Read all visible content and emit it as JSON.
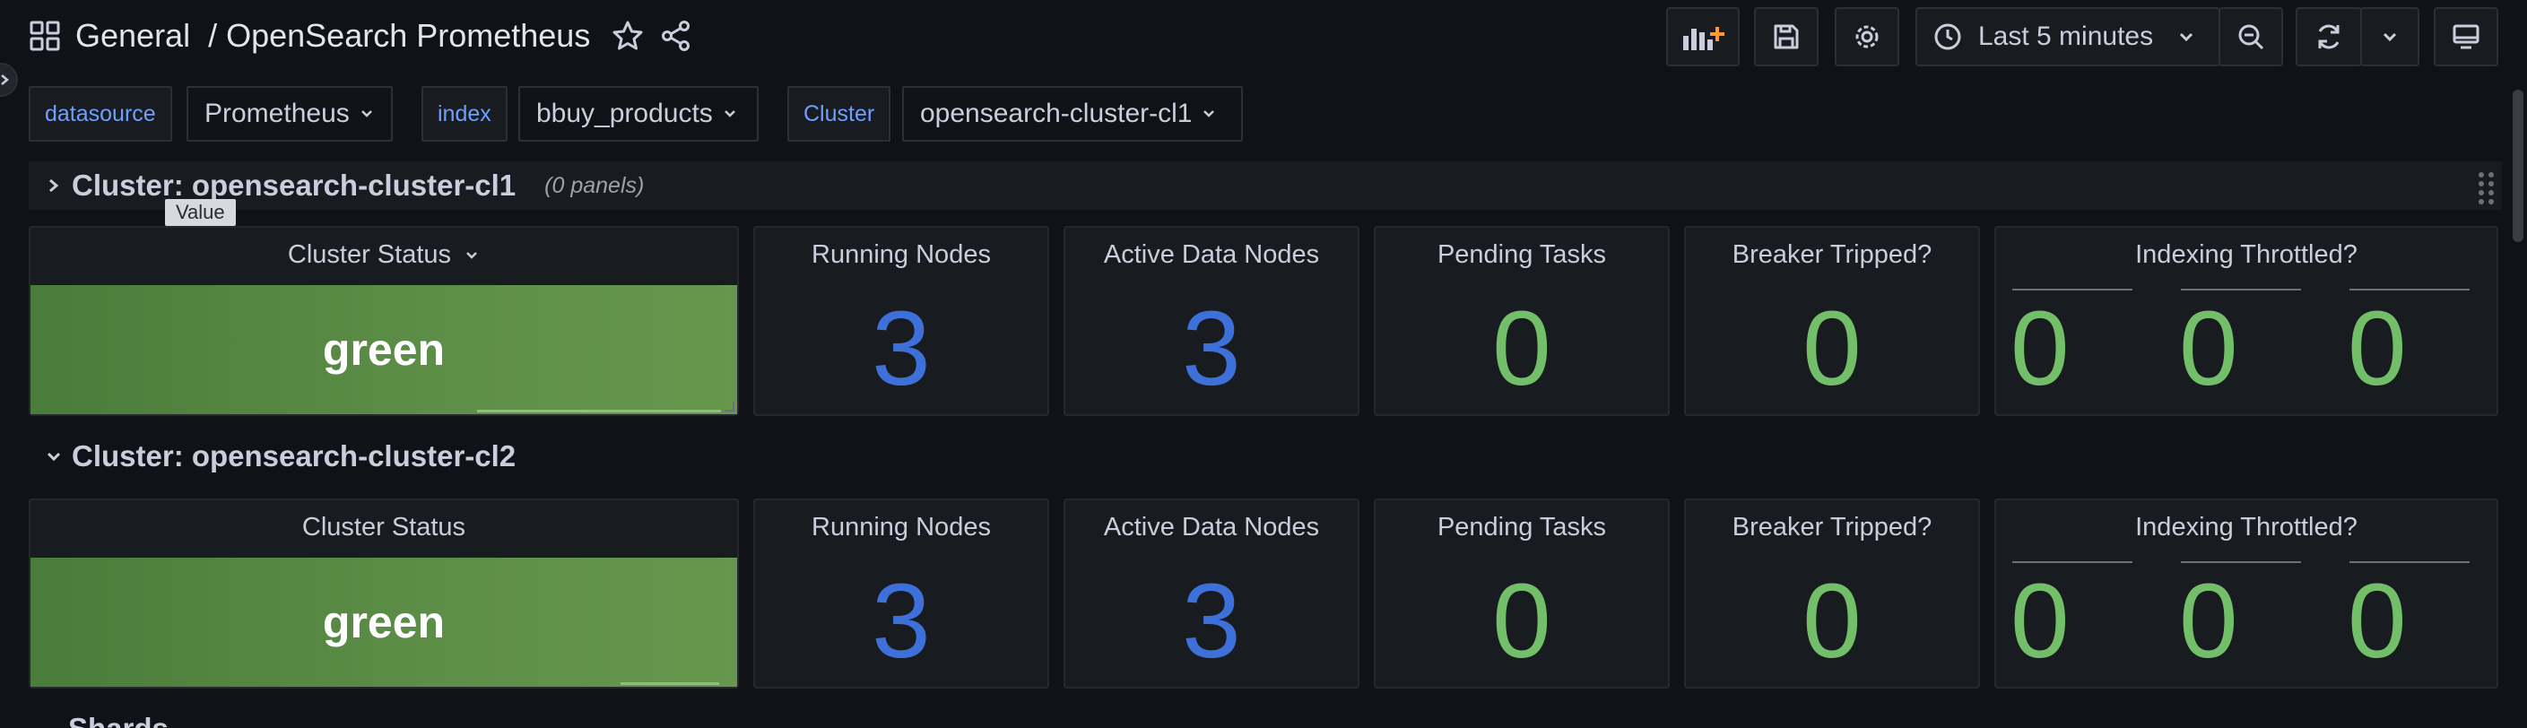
{
  "header": {
    "breadcrumb_root": "General",
    "breadcrumb_sep": "/",
    "dashboard_title": "OpenSearch Prometheus",
    "time_range": "Last 5 minutes"
  },
  "variables": {
    "datasource_label": "datasource",
    "datasource_value": "Prometheus",
    "index_label": "index",
    "index_value": "bbuy_products",
    "cluster_label": "Cluster",
    "cluster_value": "opensearch-cluster-cl1"
  },
  "tooltip": "Value",
  "rows": [
    {
      "title": "Cluster: opensearch-cluster-cl1",
      "panel_count": "(0 panels)",
      "panels": {
        "cluster_status_title": "Cluster Status",
        "cluster_status_value": "green",
        "running_nodes_title": "Running Nodes",
        "running_nodes_value": "3",
        "active_data_nodes_title": "Active Data Nodes",
        "active_data_nodes_value": "3",
        "pending_tasks_title": "Pending Tasks",
        "pending_tasks_value": "0",
        "breaker_tripped_title": "Breaker Tripped?",
        "breaker_tripped_value": "0",
        "indexing_throttled_title": "Indexing Throttled?",
        "indexing_throttled_values": [
          "0",
          "0",
          "0"
        ]
      }
    },
    {
      "title": "Cluster: opensearch-cluster-cl2",
      "panels": {
        "cluster_status_title": "Cluster Status",
        "cluster_status_value": "green",
        "running_nodes_title": "Running Nodes",
        "running_nodes_value": "3",
        "active_data_nodes_title": "Active Data Nodes",
        "active_data_nodes_value": "3",
        "pending_tasks_title": "Pending Tasks",
        "pending_tasks_value": "0",
        "breaker_tripped_title": "Breaker Tripped?",
        "breaker_tripped_value": "0",
        "indexing_throttled_title": "Indexing Throttled?",
        "indexing_throttled_values": [
          "0",
          "0",
          "0"
        ]
      }
    }
  ],
  "next_row_title": "Shards",
  "colors": {
    "value_blue": "#3d71d9",
    "value_green": "#73bf69",
    "status_green": "#5e8f48",
    "background": "#111217",
    "panel": "#181b1f"
  },
  "icons": {
    "apps": "grid-icon",
    "star": "star-icon",
    "share": "share-icon",
    "add_panel": "add-panel-icon",
    "save": "save-icon",
    "settings": "gear-icon",
    "clock": "clock-icon",
    "zoom_out": "zoom-out-icon",
    "refresh": "refresh-icon",
    "tv": "tv-mode-icon"
  }
}
